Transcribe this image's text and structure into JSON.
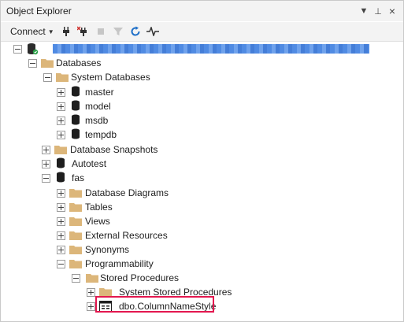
{
  "window": {
    "title": "Object Explorer"
  },
  "titlebar_icons": {
    "dropdown": "▼",
    "pin": "⊥",
    "close": "×"
  },
  "toolbar": {
    "connect_label": "Connect",
    "icons": [
      "connect-plug-icon",
      "disconnect-plug-icon",
      "stop-icon",
      "filter-icon",
      "refresh-icon",
      "activity-monitor-icon"
    ]
  },
  "tree": {
    "server_label": "",
    "databases": "Databases",
    "system_databases": "System Databases",
    "system_items": [
      "master",
      "model",
      "msdb",
      "tempdb"
    ],
    "database_snapshots": "Database Snapshots",
    "autotest": "Autotest",
    "fas": "fas",
    "fas_children": [
      "Database Diagrams",
      "Tables",
      "Views",
      "External Resources",
      "Synonyms",
      "Programmability"
    ],
    "stored_procedures": "Stored Procedures",
    "system_stored_procedures": "System Stored Procedures",
    "selected_procedure": "dbo.ColumnNameStyle"
  },
  "colors": {
    "folder": "#dcb67a",
    "highlight_border": "#e3174f",
    "redaction": "#3d7ee0"
  }
}
